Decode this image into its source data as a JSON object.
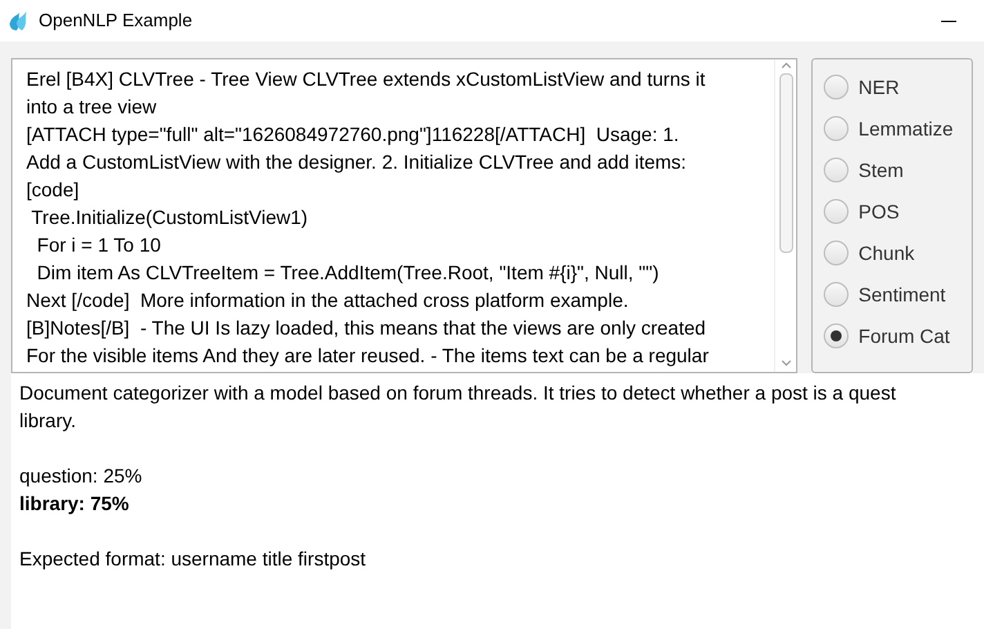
{
  "window": {
    "title": "OpenNLP Example"
  },
  "input": {
    "lines": [
      "Erel [B4X] CLVTree - Tree View CLVTree extends xCustomListView and turns it",
      "into a tree view",
      "[ATTACH type=\"full\" alt=\"1626084972760.png\"]116228[/ATTACH]  Usage: 1.",
      "Add a CustomListView with the designer. 2. Initialize CLVTree and add items:",
      "[code]",
      " Tree.Initialize(CustomListView1)",
      "  For i = 1 To 10",
      "  Dim item As CLVTreeItem = Tree.AddItem(Tree.Root, \"Item #{i}\", Null, \"\")",
      "Next [/code]  More information in the attached cross platform example.",
      "[B]Notes[/B]  - The UI Is lazy loaded, this means that the views are only created",
      "For the visible items And they are later reused. - The items text can be a regular"
    ]
  },
  "modes": [
    {
      "label": "NER",
      "selected": false
    },
    {
      "label": "Lemmatize",
      "selected": false
    },
    {
      "label": "Stem",
      "selected": false
    },
    {
      "label": "POS",
      "selected": false
    },
    {
      "label": "Chunk",
      "selected": false
    },
    {
      "label": "Sentiment",
      "selected": false
    },
    {
      "label": "Forum Cat",
      "selected": true
    }
  ],
  "output": {
    "description": [
      "Document categorizer with a model based on forum threads. It tries to detect whether a post is a quest",
      "library."
    ],
    "results": [
      {
        "text": "question: 25%",
        "selected": false
      },
      {
        "text": "library: 75%",
        "selected": true
      }
    ],
    "format": "Expected format: username title firstpost"
  }
}
